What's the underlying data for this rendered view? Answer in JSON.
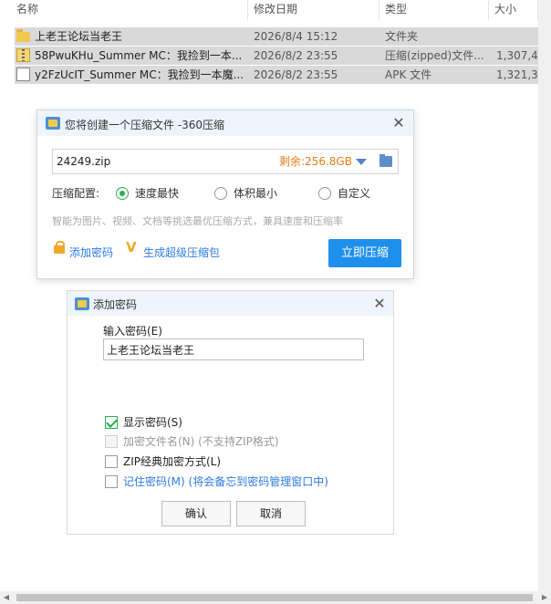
{
  "explorer": {
    "columns": {
      "name": "名称",
      "date": "修改日期",
      "type": "类型",
      "size": "大小"
    },
    "files": [
      {
        "name": "上老王论坛当老王",
        "date": "2026/8/4 15:12",
        "type": "文件夹",
        "size": "",
        "icon": "folder-icon"
      },
      {
        "name": "58PwuKHu_Summer MC：我捡到一本...",
        "date": "2026/8/2 23:55",
        "type": "压缩(zipped)文件...",
        "size": "1,307,4",
        "icon": "zip-icon"
      },
      {
        "name": "y2FzUcIT_Summer MC：我捡到一本魔...",
        "date": "2026/8/2 23:55",
        "type": "APK 文件",
        "size": "1,321,3",
        "icon": "apk-icon"
      }
    ]
  },
  "dialog360": {
    "title": "您将创建一个压缩文件 -360压缩",
    "filename": "24249.zip",
    "free_space": "剩余:256.8GB",
    "config_label": "压缩配置:",
    "options": [
      "速度最快",
      "体积最小",
      "自定义"
    ],
    "selected_option": "速度最快",
    "hint": "智能为图片、视频、文档等挑选最优压缩方式，兼具速度和压缩率",
    "add_password": "添加密码",
    "super_pack": "生成超级压缩包",
    "compress_button": "立即压缩"
  },
  "password_dialog": {
    "title": "添加密码",
    "input_label": "输入密码(E)",
    "password_value": "上老王论坛当老王",
    "checkboxes": [
      {
        "label": "显示密码(S)",
        "checked": true,
        "enabled": true
      },
      {
        "label": "加密文件名(N) (不支持ZIP格式)",
        "checked": false,
        "enabled": false
      },
      {
        "label": "ZIP经典加密方式(L)",
        "checked": false,
        "enabled": true
      },
      {
        "label": "记住密码(M) (将会备忘到密码管理窗口中)",
        "checked": false,
        "enabled": true
      }
    ],
    "ok_button": "确认",
    "cancel_button": "取消"
  },
  "colors": {
    "accent": "#1e90ec",
    "check_green": "#27b148",
    "free_space_orange": "#e57c1b",
    "link_blue": "#2c7be5",
    "hint_gray": "#aaaaaa"
  }
}
